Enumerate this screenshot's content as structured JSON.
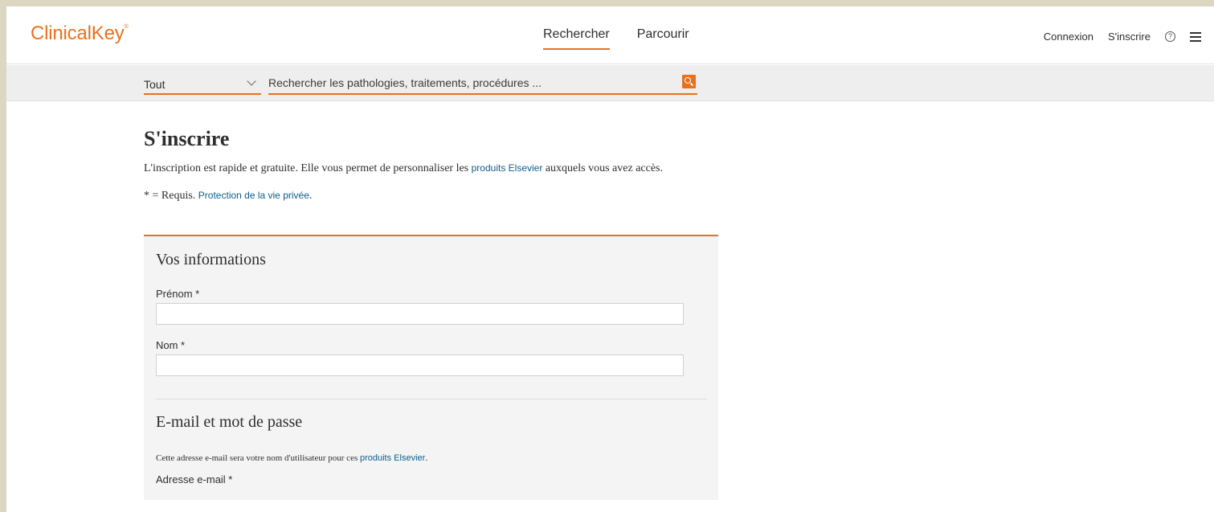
{
  "header": {
    "logo": "ClinicalKey",
    "logo_mark": "®",
    "nav": [
      {
        "label": "Rechercher",
        "active": true
      },
      {
        "label": "Parcourir",
        "active": false
      }
    ],
    "login": "Connexion",
    "register": "S'inscrire",
    "help_icon": "?",
    "menu_icon": "hamburger-icon"
  },
  "search": {
    "scope": "Tout",
    "placeholder": "Rechercher les pathologies, traitements, procédures ...",
    "button_icon": "search-icon"
  },
  "page": {
    "title": "S'inscrire",
    "intro_before": "L'inscription est rapide et gratuite. Elle vous permet de personnaliser les ",
    "intro_link": "produits Elsevier",
    "intro_after": " auxquels vous avez accès.",
    "required_text": "* = Requis. ",
    "privacy_link": "Protection de la vie privée",
    "privacy_after": "."
  },
  "form": {
    "section1_title": "Vos informations",
    "first_name_label": "Prénom *",
    "first_name_value": "",
    "last_name_label": "Nom *",
    "last_name_value": "",
    "section2_title": "E-mail et mot de passe",
    "email_note_before": "Cette adresse e-mail sera votre nom d'utilisateur pour ces ",
    "email_note_link": "produits Elsevier",
    "email_note_after": ".",
    "email_label": "Adresse e-mail *"
  },
  "colors": {
    "accent": "#e9711c",
    "link": "#0c5f8c",
    "frame": "#ddd7c2"
  }
}
